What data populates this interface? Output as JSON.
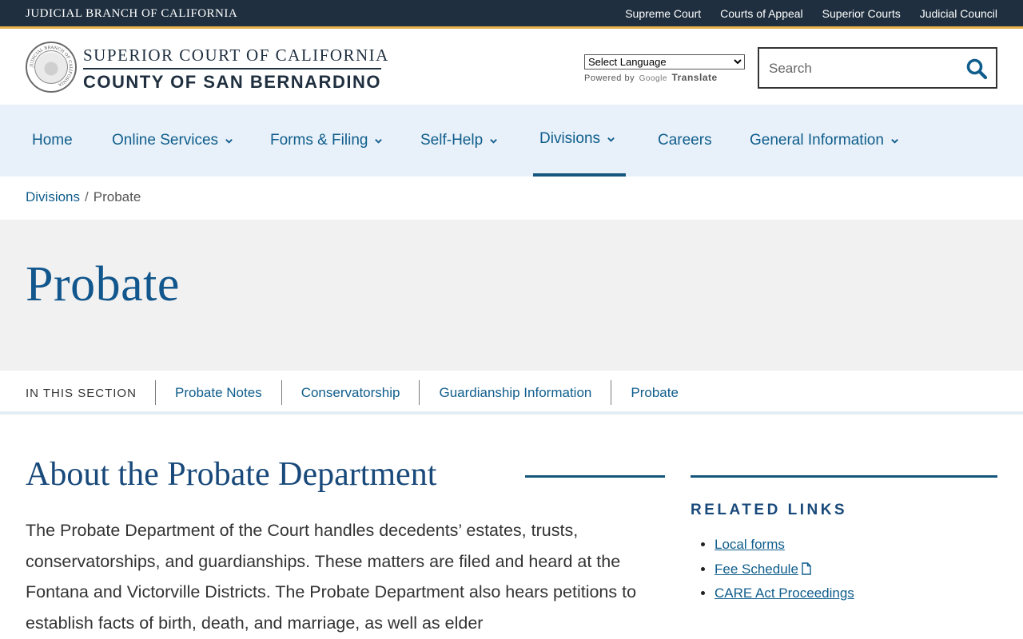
{
  "topbar": {
    "brand": "JUDICIAL BRANCH OF CALIFORNIA",
    "links": [
      "Supreme Court",
      "Courts of Appeal",
      "Superior Courts",
      "Judicial Council"
    ]
  },
  "header": {
    "court_line1": "SUPERIOR COURT OF CALIFORNIA",
    "court_line2": "COUNTY OF SAN BERNARDINO",
    "seal_text": "JUDICIAL BRANCH OF CALIFORNIA",
    "translate": {
      "select_label": "Select Language",
      "powered": "Powered by",
      "google": "Google",
      "translate": "Translate"
    },
    "search": {
      "placeholder": "Search"
    }
  },
  "nav": {
    "items": [
      {
        "label": "Home"
      },
      {
        "label": "Online Services"
      },
      {
        "label": "Forms & Filing"
      },
      {
        "label": "Self-Help"
      },
      {
        "label": "Divisions"
      },
      {
        "label": "Careers"
      },
      {
        "label": "General Information"
      }
    ]
  },
  "breadcrumb": {
    "parent": "Divisions",
    "separator": "/",
    "current": "Probate"
  },
  "hero": {
    "title": "Probate"
  },
  "section_nav": {
    "label": "IN THIS SECTION",
    "links": [
      "Probate Notes",
      "Conservatorship",
      "Guardianship Information",
      "Probate"
    ]
  },
  "content": {
    "title": "About the Probate Department",
    "body": "The Probate Department of the Court handles decedents’ estates, trusts, conservatorships, and guardianships. These matters are filed and heard at the Fontana and Victorville Districts. The Probate Department also hears petitions to establish facts of birth, death, and marriage, as well as elder"
  },
  "sidebar": {
    "heading": "RELATED LINKS",
    "links": [
      "Local forms",
      "Fee Schedule",
      "CARE Act Proceedings"
    ]
  },
  "colors": {
    "topbar_bg": "#1f2f3f",
    "topbar_accent": "#e6b24a",
    "nav_bg": "#e8f1f9",
    "link": "#0f5d8c",
    "heading": "#18497a",
    "hero_bg": "#f1f1f1"
  },
  "icons": {
    "search": "search-icon",
    "chevron": "chevron-down-icon",
    "document": "document-icon",
    "seal": "court-seal"
  }
}
